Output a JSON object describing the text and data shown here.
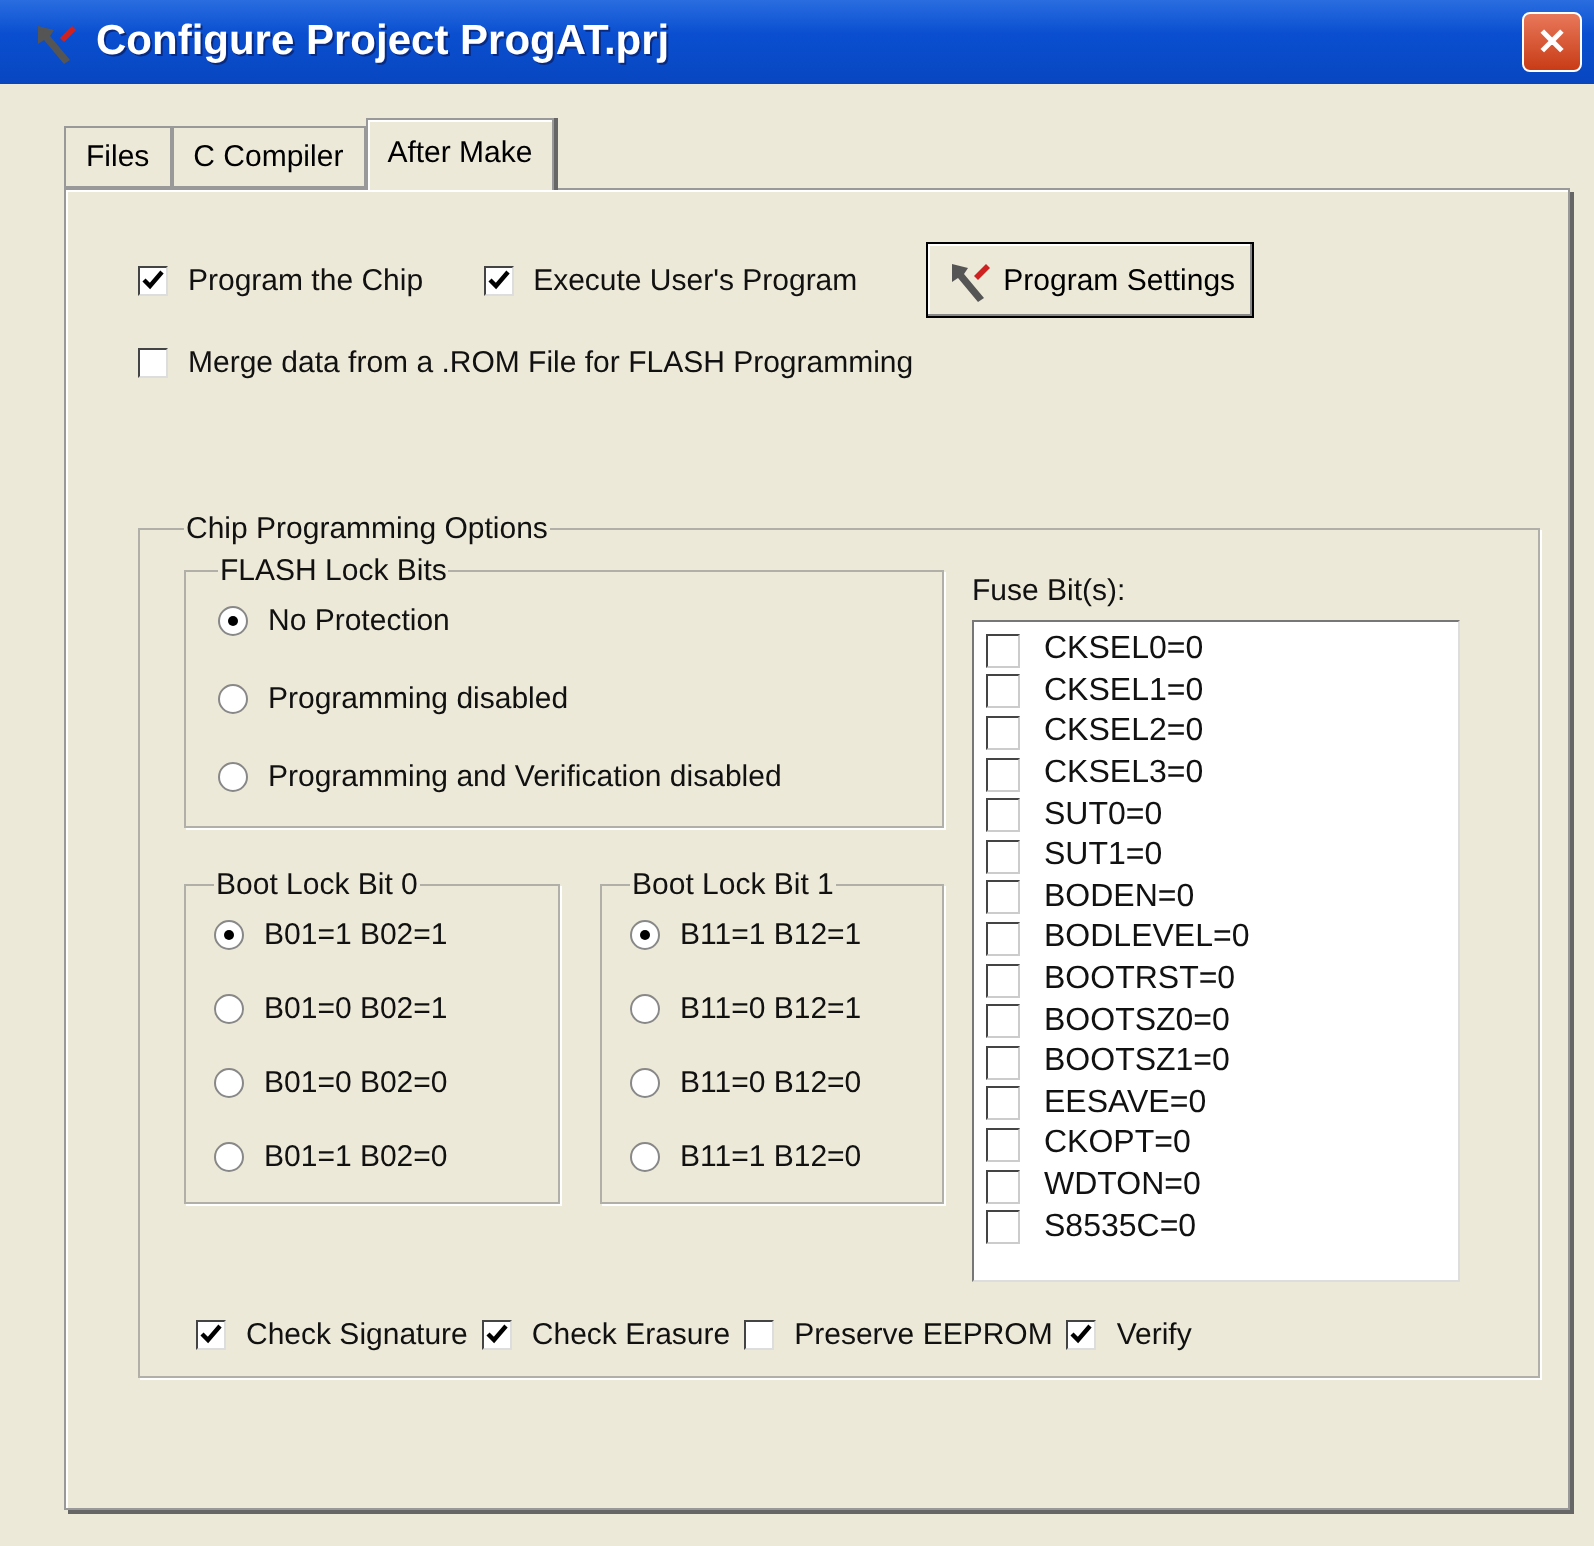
{
  "window": {
    "title": "Configure Project ProgAT.prj",
    "close": "✕"
  },
  "tabs": [
    {
      "label": "Files",
      "selected": false
    },
    {
      "label": "C Compiler",
      "selected": false
    },
    {
      "label": "After Make",
      "selected": true
    }
  ],
  "options": [
    {
      "label": "Program the Chip",
      "checked": true
    },
    {
      "label": "Execute User's Program",
      "checked": true
    }
  ],
  "settings_button": "Program Settings",
  "merge": {
    "label": "Merge data from a .ROM File for FLASH Programming",
    "checked": false
  },
  "chip_options": {
    "title": "Chip Programming Options",
    "flash_lock": {
      "title": "FLASH Lock Bits",
      "items": [
        {
          "label": "No Protection",
          "selected": true
        },
        {
          "label": "Programming disabled",
          "selected": false
        },
        {
          "label": "Programming and Verification disabled",
          "selected": false
        }
      ]
    },
    "boot_lock": [
      {
        "title": "Boot Lock Bit 0",
        "items": [
          {
            "label": "B01=1 B02=1",
            "selected": true
          },
          {
            "label": "B01=0 B02=1",
            "selected": false
          },
          {
            "label": "B01=0 B02=0",
            "selected": false
          },
          {
            "label": "B01=1 B02=0",
            "selected": false
          }
        ]
      },
      {
        "title": "Boot Lock Bit 1",
        "items": [
          {
            "label": "B11=1 B12=1",
            "selected": true
          },
          {
            "label": "B11=0 B12=1",
            "selected": false
          },
          {
            "label": "B11=0 B12=0",
            "selected": false
          },
          {
            "label": "B11=1 B12=0",
            "selected": false
          }
        ]
      }
    ],
    "fuse_label": "Fuse Bit(s):",
    "fuses": [
      {
        "label": "CKSEL0=0",
        "checked": false
      },
      {
        "label": "CKSEL1=0",
        "checked": false
      },
      {
        "label": "CKSEL2=0",
        "checked": false
      },
      {
        "label": "CKSEL3=0",
        "checked": false
      },
      {
        "label": "SUT0=0",
        "checked": false
      },
      {
        "label": "SUT1=0",
        "checked": false
      },
      {
        "label": "BODEN=0",
        "checked": false
      },
      {
        "label": "BODLEVEL=0",
        "checked": false
      },
      {
        "label": "BOOTRST=0",
        "checked": false
      },
      {
        "label": "BOOTSZ0=0",
        "checked": false
      },
      {
        "label": "BOOTSZ1=0",
        "checked": false
      },
      {
        "label": "EESAVE=0",
        "checked": false
      },
      {
        "label": "CKOPT=0",
        "checked": false
      },
      {
        "label": "WDTON=0",
        "checked": false
      },
      {
        "label": "S8535C=0",
        "checked": false
      }
    ],
    "checks": [
      {
        "label": "Check Signature",
        "checked": true
      },
      {
        "label": "Check Erasure",
        "checked": true
      },
      {
        "label": "Preserve EEPROM",
        "checked": false
      },
      {
        "label": "Verify",
        "checked": true
      }
    ]
  }
}
